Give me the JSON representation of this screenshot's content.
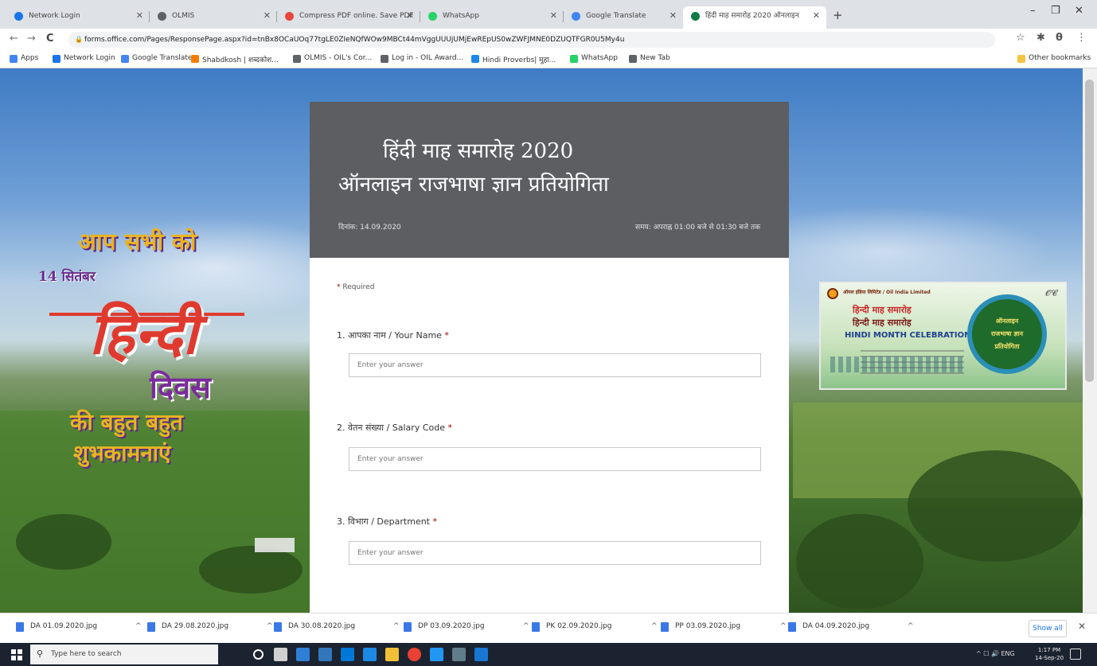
{
  "browser": {
    "tabs": [
      {
        "title": "Network Login",
        "favicon_color": "#1a73e8"
      },
      {
        "title": "OLMIS",
        "favicon_color": "#5f6368"
      },
      {
        "title": "Compress PDF online. Save PDF",
        "favicon_color": "#e8453c"
      },
      {
        "title": "WhatsApp",
        "favicon_color": "#25d366"
      },
      {
        "title": "Google Translate",
        "favicon_color": "#4285f4"
      },
      {
        "title": "हिंदी माह समारोह 2020 ऑनलाइन",
        "favicon_color": "#0f7b43"
      }
    ],
    "new_tab_symbol": "+",
    "window_controls": {
      "minimize": "–",
      "maximize": "❐",
      "close": "✕"
    },
    "nav": {
      "back": "←",
      "forward": "→",
      "reload": "C"
    },
    "url": "forms.office.com/Pages/ResponsePage.aspx?id=tnBx8OCaUOq77tgLE0ZIeNQfWOw9MBCt44mVggUUUjUMjEwREpUS0wZWFJMNE0DZUQTFGR0U5My4u",
    "toolbar_icons": [
      "star-icon",
      "extensions-icon",
      "profile-icon",
      "menu-icon"
    ],
    "toolbar_glyphs": [
      "☆",
      "✱",
      "θ",
      "⋮"
    ],
    "bookmarks": [
      {
        "label": "Apps",
        "color": "#4285f4"
      },
      {
        "label": "Network Login",
        "color": "#1a73e8"
      },
      {
        "label": "Google Translate",
        "color": "#4285f4"
      },
      {
        "label": "Shabdkosh | शब्दकोश...",
        "color": "#f57c00"
      },
      {
        "label": "OLMIS - OIL's Cor...",
        "color": "#5f6368"
      },
      {
        "label": "Log in - OIL Award...",
        "color": "#5f6368"
      },
      {
        "label": "Hindi Proverbs| मुहा...",
        "color": "#1e88e5"
      },
      {
        "label": "WhatsApp",
        "color": "#25d366"
      },
      {
        "label": "New Tab",
        "color": "#5f6368"
      }
    ],
    "other_bookmarks": "Other bookmarks"
  },
  "greeting": {
    "line1": "आप सभी को",
    "line2": "14 सितंबर",
    "line3": "हिन्दी",
    "line4": "दिवस",
    "line5": "की बहुत बहुत",
    "line6": "शुभकामनाएं"
  },
  "form": {
    "title_line1": "हिंदी माह समारोह 2020",
    "title_line2": "ऑनलाइन राजभाषा ज्ञान प्रतियोगिता",
    "date": "दिनांक: 14.09.2020",
    "time": "समय: अपराह्न 01:00 बजे से 01:30 बजे तक",
    "required_note": "Required",
    "questions": [
      {
        "label": "1. आपका नाम / Your Name",
        "placeholder": "Enter your answer"
      },
      {
        "label": "2. वेतन संख्या / Salary Code",
        "placeholder": "Enter your answer"
      },
      {
        "label": "3. विभाग / Department",
        "placeholder": "Enter your answer"
      }
    ]
  },
  "banner": {
    "org": "ऑयल इंडिया लिमिटेड / Oil India Limited",
    "line1": "हिन्दी माह समारोह",
    "line2": "हिन्दी माह समारोह",
    "line3": "HINDI MONTH CELEBRATION",
    "circle_line1": "ऑनलाइन",
    "circle_line2": "राजभाषा ज्ञान",
    "circle_line3": "प्रतियोगिता",
    "mark": "𝓞𝓒"
  },
  "downloads": {
    "files": [
      "DA 01.09.2020.jpg",
      "DA 29.08.2020.jpg",
      "DA 30.08.2020.jpg",
      "DP 03.09.2020.jpg",
      "PK 02.09.2020.jpg",
      "PP 03.09.2020.jpg",
      "DA 04.09.2020.jpg"
    ],
    "chevron": "^",
    "show_all": "Show all",
    "close": "✕"
  },
  "taskbar": {
    "search_placeholder": "Type here to search",
    "search_glyph": "⚲",
    "apps": [
      {
        "name": "cortana",
        "color": "#ffffff"
      },
      {
        "name": "task-view",
        "color": "#d0d0d0"
      },
      {
        "name": "mail",
        "color": "#2f7fd6"
      },
      {
        "name": "edge",
        "color": "#3277bc"
      },
      {
        "name": "store",
        "color": "#0078d7"
      },
      {
        "name": "photos",
        "color": "#1e88e5"
      },
      {
        "name": "explorer",
        "color": "#f2c037"
      },
      {
        "name": "chrome",
        "color": "#e94235"
      },
      {
        "name": "app-9",
        "color": "#2196f3"
      },
      {
        "name": "app-10",
        "color": "#607d8b"
      },
      {
        "name": "app-11",
        "color": "#1976d2"
      }
    ],
    "tray_text": "^ ☐ 🔊 ENG",
    "time": "1:17 PM",
    "date": "14-Sep-20"
  }
}
